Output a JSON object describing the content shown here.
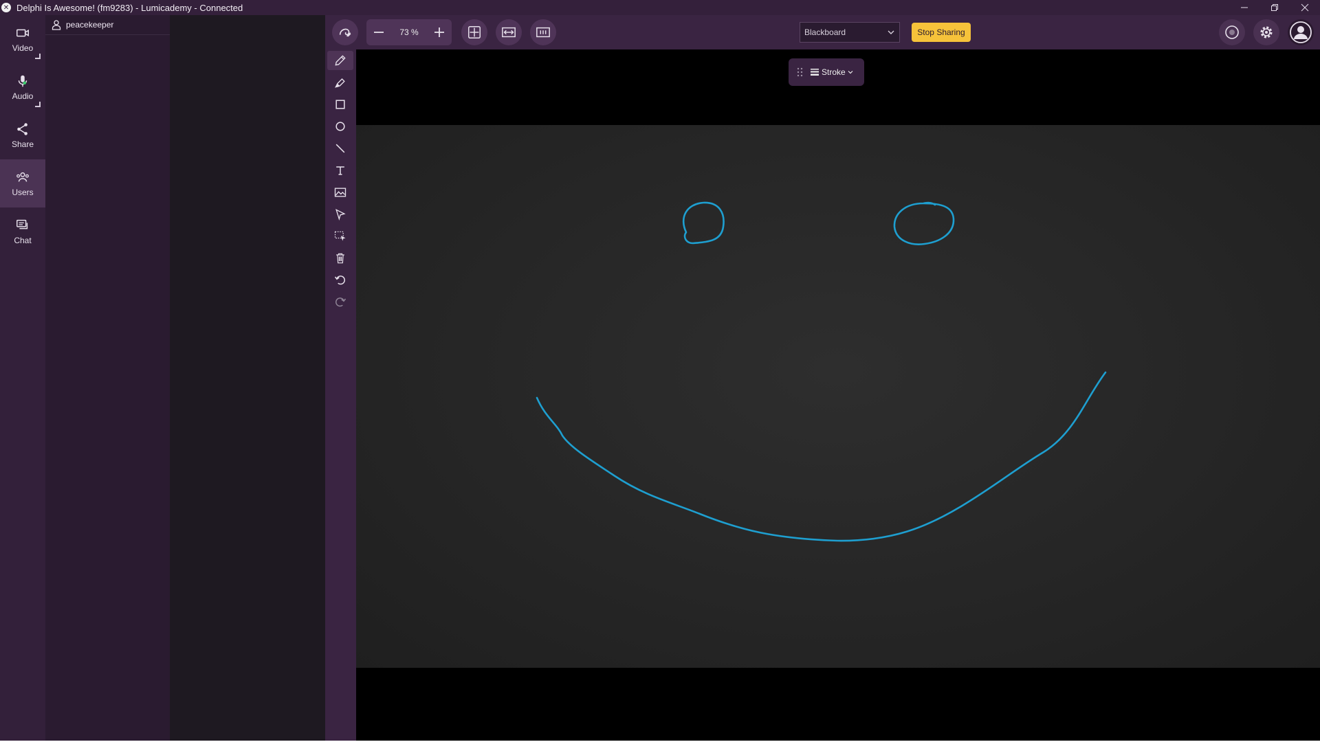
{
  "window": {
    "title": "Delphi Is Awesome! (fm9283) - Lumicademy - Connected",
    "controls": [
      "minimize-icon",
      "restore-icon",
      "close-icon"
    ]
  },
  "nav": {
    "items": [
      {
        "label": "Video",
        "icon": "video-camera-icon"
      },
      {
        "label": "Audio",
        "icon": "microphone-icon"
      },
      {
        "label": "Share",
        "icon": "share-icon"
      },
      {
        "label": "Users",
        "icon": "users-icon",
        "active": true
      },
      {
        "label": "Chat",
        "icon": "chat-icon"
      }
    ]
  },
  "users": [
    {
      "name": "peacekeeper",
      "icon": "user-icon"
    }
  ],
  "toolbar": {
    "zoom": "73 %",
    "board_select": "Blackboard",
    "stop_sharing": "Stop Sharing"
  },
  "stroke_menu": {
    "label": "Stroke"
  },
  "tools": [
    "pen-icon",
    "highlighter-icon",
    "rectangle-icon",
    "circle-icon",
    "line-icon",
    "text-icon",
    "image-icon",
    "pointer-icon",
    "selection-icon",
    "trash-icon",
    "undo-icon",
    "redo-icon"
  ],
  "colors": {
    "nav_bg": "#33203a",
    "toolbar_bg": "#3a2442",
    "accent_yellow": "#f6c23a",
    "ink_blue": "#1e9fd0",
    "board_bg": "#262626"
  }
}
